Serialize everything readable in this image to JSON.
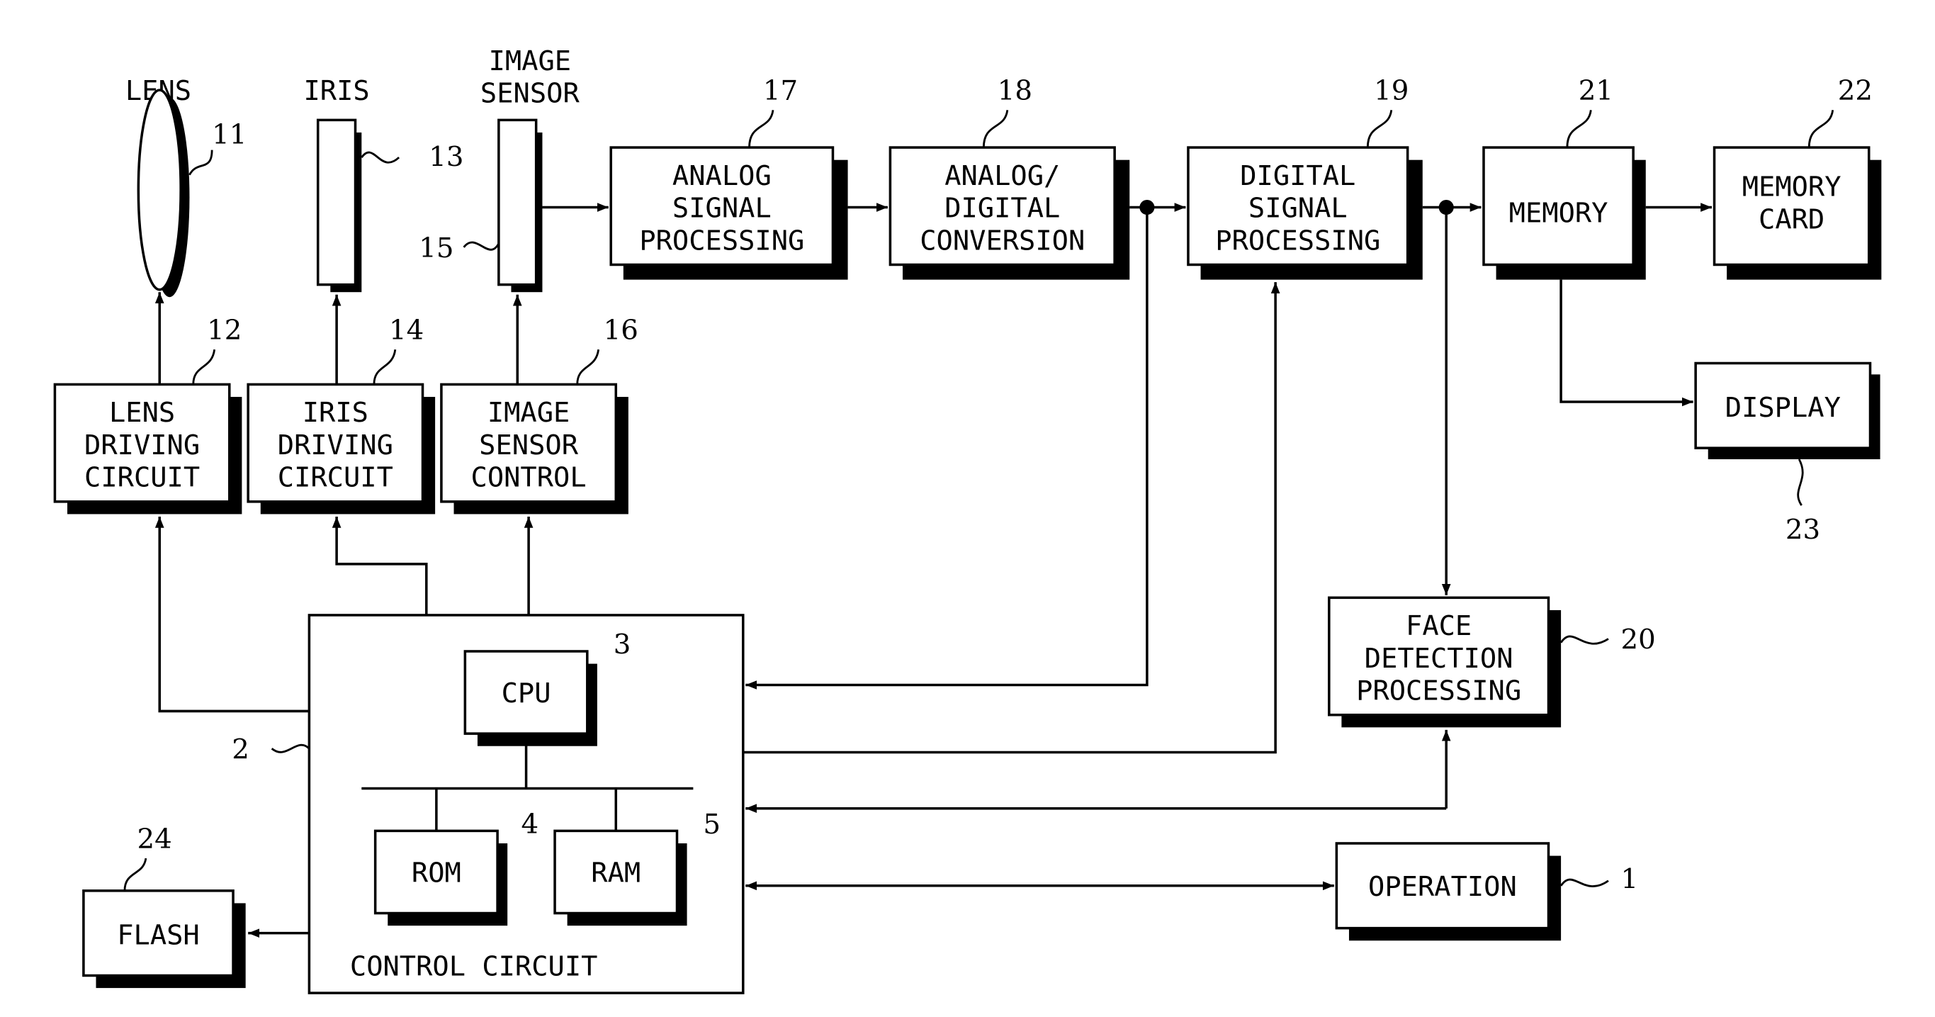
{
  "diagram": {
    "title": "",
    "components": {
      "lens": {
        "label": [
          "LENS"
        ],
        "ref": "11"
      },
      "iris": {
        "label": [
          "IRIS"
        ],
        "ref": "13"
      },
      "image_sensor": {
        "label": [
          "IMAGE",
          "SENSOR"
        ],
        "ref": "15"
      },
      "analog_signal_processing": {
        "label": [
          "ANALOG",
          "SIGNAL",
          "PROCESSING"
        ],
        "ref": "17"
      },
      "adc": {
        "label": [
          "ANALOG/",
          "DIGITAL",
          "CONVERSION"
        ],
        "ref": "18"
      },
      "digital_signal_processing": {
        "label": [
          "DIGITAL",
          "SIGNAL",
          "PROCESSING"
        ],
        "ref": "19"
      },
      "memory": {
        "label": [
          "MEMORY"
        ],
        "ref": "21"
      },
      "memory_card": {
        "label": [
          "MEMORY",
          "CARD"
        ],
        "ref": "22"
      },
      "display": {
        "label": [
          "DISPLAY"
        ],
        "ref": "23"
      },
      "lens_driving_circuit": {
        "label": [
          "LENS",
          "DRIVING",
          "CIRCUIT"
        ],
        "ref": "12"
      },
      "iris_driving_circuit": {
        "label": [
          "IRIS",
          "DRIVING",
          "CIRCUIT"
        ],
        "ref": "14"
      },
      "image_sensor_control": {
        "label": [
          "IMAGE",
          "SENSOR",
          "CONTROL"
        ],
        "ref": "16"
      },
      "face_detection_processing": {
        "label": [
          "FACE",
          "DETECTION",
          "PROCESSING"
        ],
        "ref": "20"
      },
      "control_circuit": {
        "label": [
          "CONTROL CIRCUIT"
        ],
        "ref": "2"
      },
      "cpu": {
        "label": [
          "CPU"
        ],
        "ref": "3"
      },
      "rom": {
        "label": [
          "ROM"
        ],
        "ref": "4"
      },
      "ram": {
        "label": [
          "RAM"
        ],
        "ref": "5"
      },
      "operation": {
        "label": [
          "OPERATION"
        ],
        "ref": "1"
      },
      "flash": {
        "label": [
          "FLASH"
        ],
        "ref": "24"
      }
    }
  }
}
